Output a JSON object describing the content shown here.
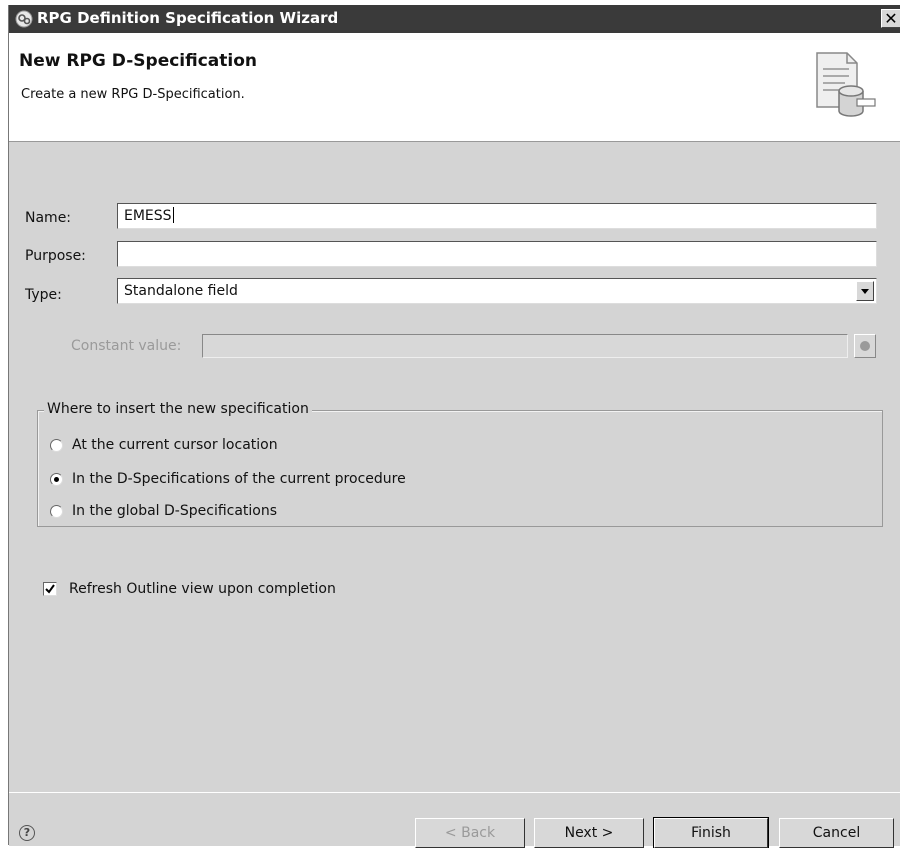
{
  "window": {
    "title": "RPG Definition Specification Wizard",
    "close_glyph": "✕"
  },
  "banner": {
    "heading": "New RPG D-Specification",
    "subheading": "Create a new RPG D-Specification."
  },
  "form": {
    "name_label": "Name:",
    "name_value": "EMESS",
    "purpose_label": "Purpose:",
    "purpose_value": "",
    "type_label": "Type:",
    "type_value": "Standalone field",
    "constant_label": "Constant value:",
    "constant_value": ""
  },
  "insert_group": {
    "legend": "Where to insert the new specification",
    "options": [
      {
        "label": "At the current cursor location",
        "selected": false
      },
      {
        "label": "In the D-Specifications of the current procedure",
        "selected": true
      },
      {
        "label": "In the global D-Specifications",
        "selected": false
      }
    ]
  },
  "refresh_option": {
    "label": "Refresh Outline view upon completion",
    "checked": true
  },
  "buttons": {
    "help_glyph": "?",
    "back": "< Back",
    "next": "Next >",
    "finish": "Finish",
    "cancel": "Cancel"
  },
  "icons": {
    "app": "wizard-app-icon",
    "banner": "document-database-icon",
    "help": "help-icon"
  },
  "colors": {
    "titlebar": "#3a3a3a",
    "dialog": "#d4d4d4",
    "banner": "#ffffff"
  }
}
